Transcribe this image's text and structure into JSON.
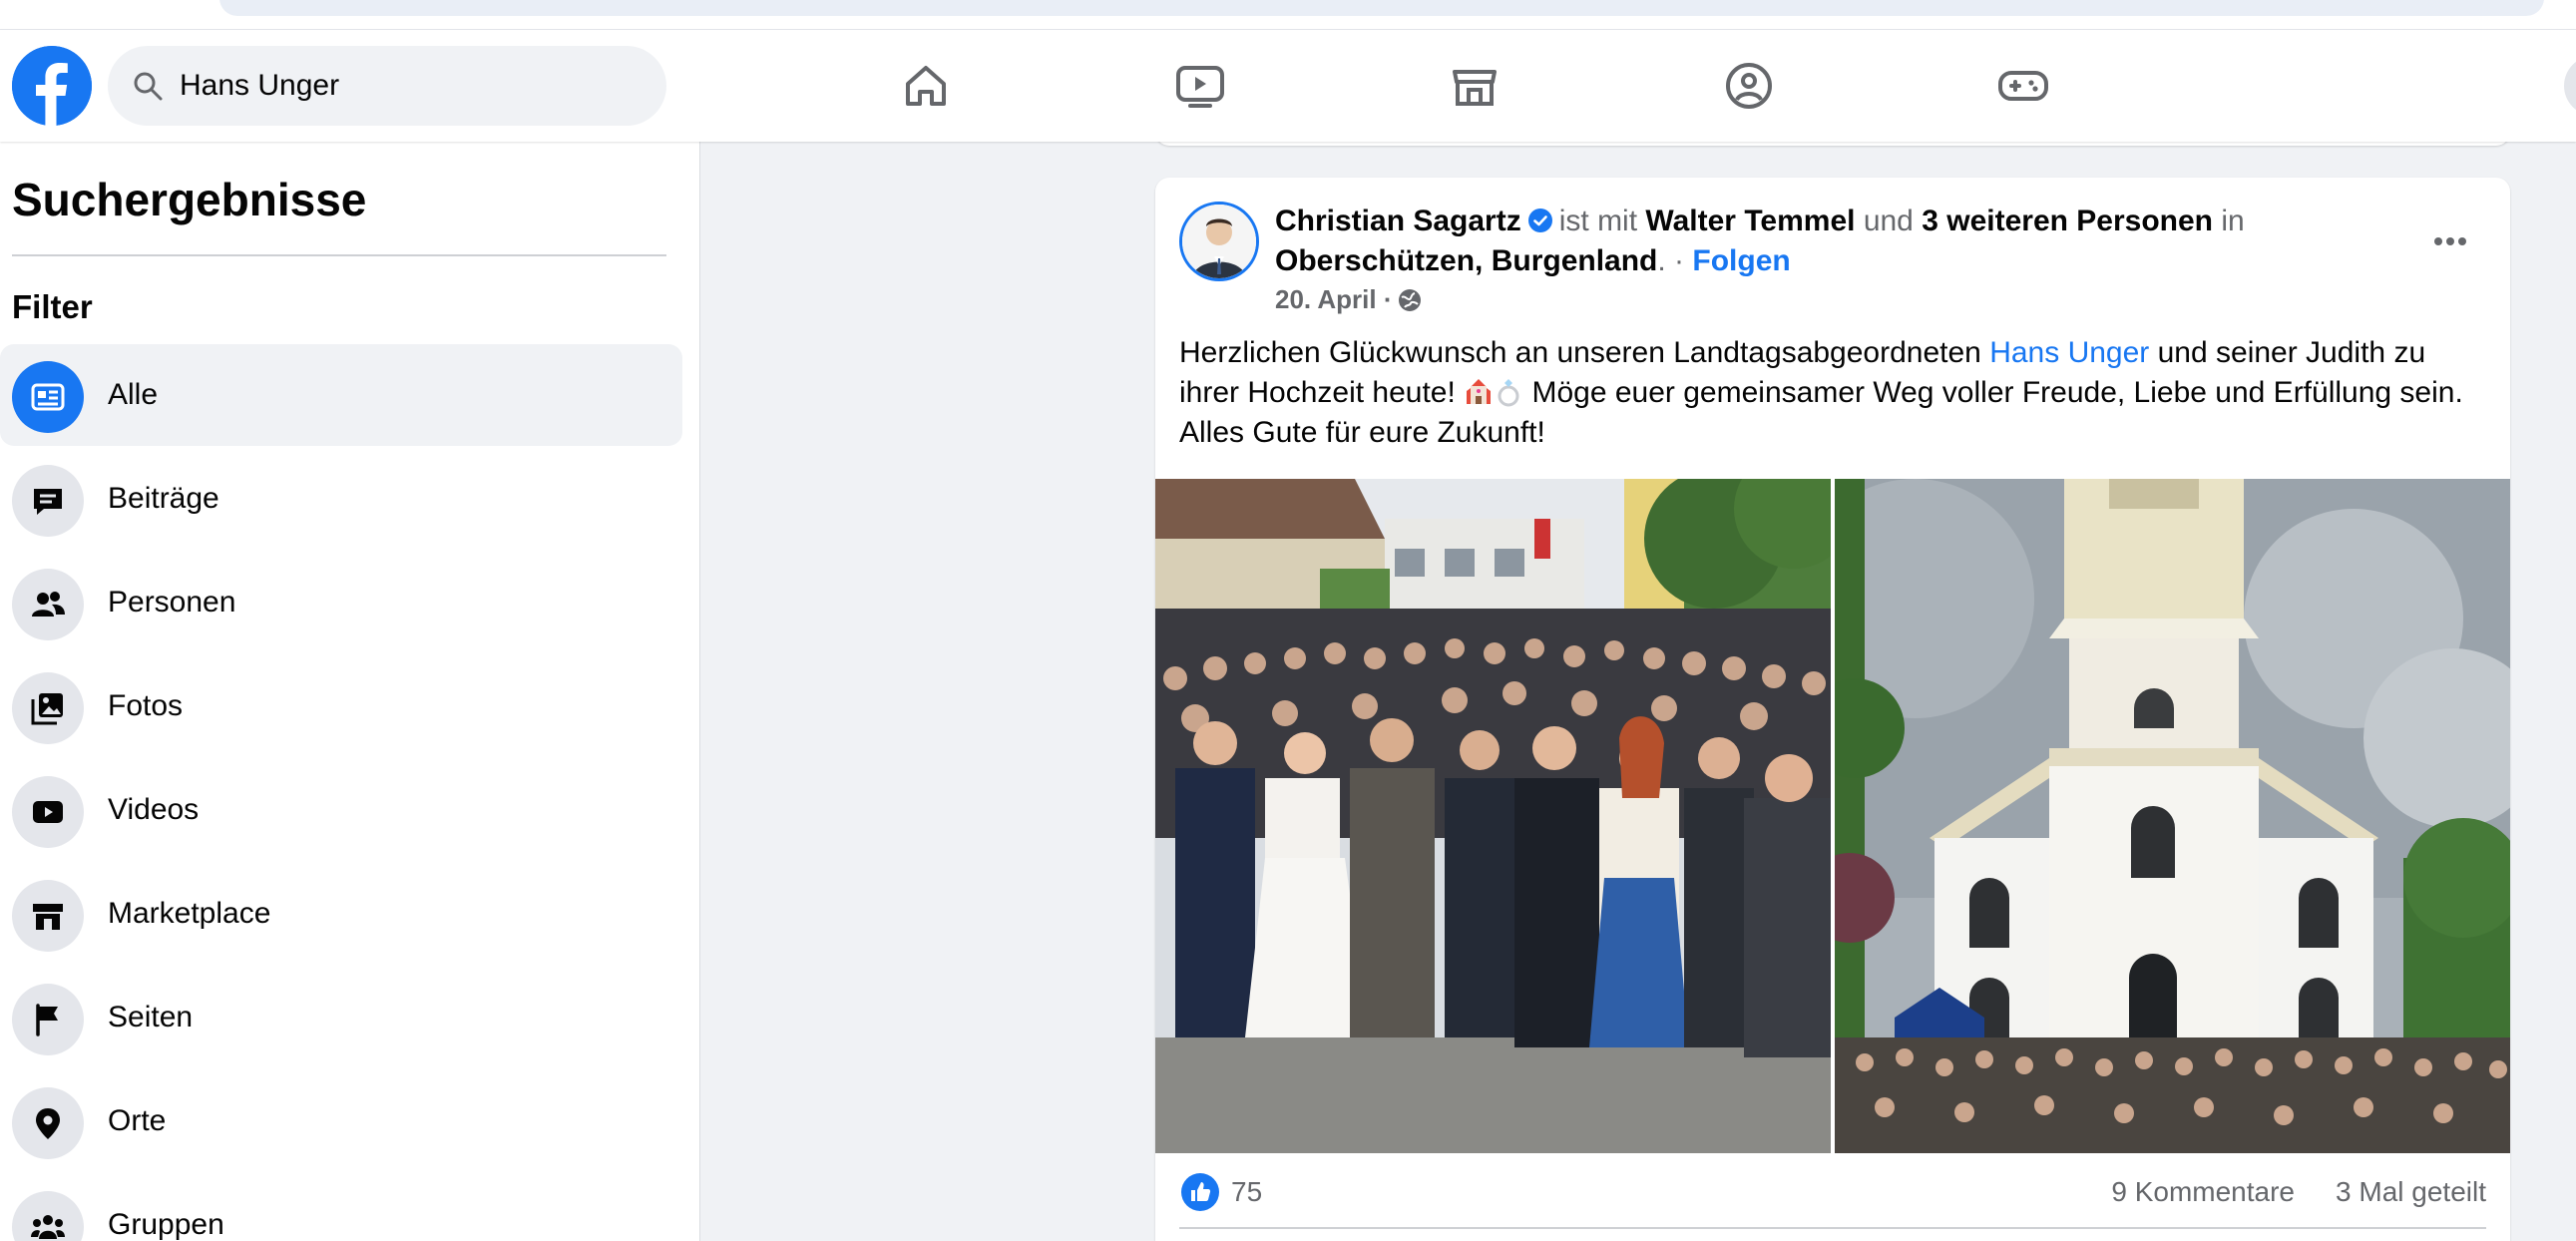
{
  "search": {
    "value": "Hans Unger"
  },
  "nav": {
    "icons": [
      "home-icon",
      "watch-icon",
      "marketplace-icon",
      "groups-icon",
      "gaming-icon"
    ]
  },
  "sidebar": {
    "title": "Suchergebnisse",
    "filter_heading": "Filter",
    "items": [
      {
        "label": "Alle",
        "icon": "all-results-icon",
        "active": true
      },
      {
        "label": "Beiträge",
        "icon": "posts-icon"
      },
      {
        "label": "Personen",
        "icon": "people-icon"
      },
      {
        "label": "Fotos",
        "icon": "photos-icon"
      },
      {
        "label": "Videos",
        "icon": "videos-icon"
      },
      {
        "label": "Marketplace",
        "icon": "marketplace-icon"
      },
      {
        "label": "Seiten",
        "icon": "pages-icon"
      },
      {
        "label": "Orte",
        "icon": "places-icon"
      },
      {
        "label": "Gruppen",
        "icon": "groups-icon"
      }
    ]
  },
  "post": {
    "author": "Christian Sagartz",
    "with_text": "ist mit",
    "tagged_person": "Walter Temmel",
    "and_text": "und",
    "others": "3 weiteren Personen",
    "in_text": "in",
    "location": "Oberschützen, Burgenland",
    "separator": ". ·",
    "follow": "Folgen",
    "date": "20. April ·",
    "text_before": "Herzlichen Glückwunsch an unseren Landtagsabgeordneten ",
    "mention": "Hans Unger",
    "text_mid": " und seiner Judith zu ihrer Hochzeit heute! ",
    "text_after": " Möge euer gemeinsamer Weg voller Freude, Liebe und Erfüllung sein. Alles Gute für eure Zukunft!",
    "likes": "75",
    "comments": "9 Kommentare",
    "shares": "3 Mal geteilt"
  },
  "colors": {
    "brand": "#1877f2",
    "text": "#050505",
    "secondary": "#65676b",
    "bg": "#f0f2f5"
  }
}
